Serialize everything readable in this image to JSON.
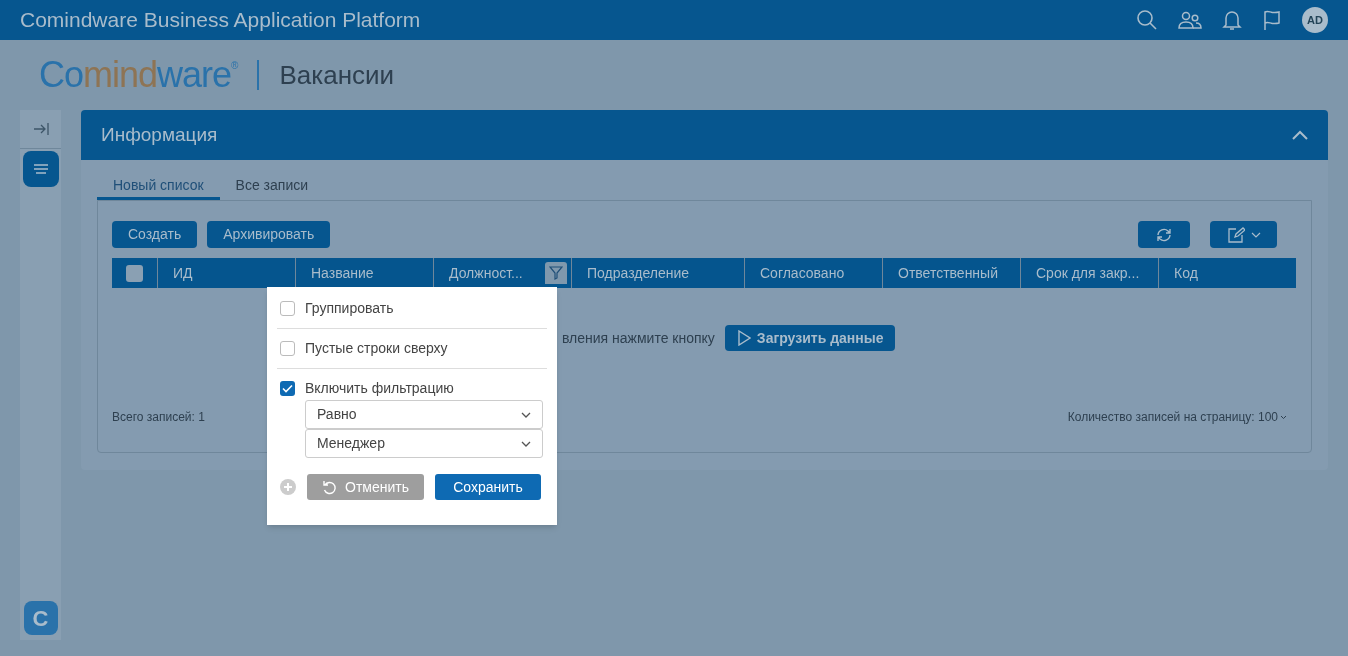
{
  "top_bar": {
    "title": "Comindware Business Application Platform",
    "avatar": "AD"
  },
  "logo": {
    "parts": [
      {
        "text": "Co",
        "color": "#2a72aa"
      },
      {
        "text": "mind",
        "color": "#8e7454"
      },
      {
        "text": "ware",
        "color": "#2a72aa"
      }
    ],
    "mark": "®"
  },
  "page_title": "Вакансии",
  "sidebar": {
    "app_badge": "C"
  },
  "card": {
    "title": "Информация",
    "expanded": true
  },
  "tabs": [
    {
      "label": "Новый список",
      "selected": true
    },
    {
      "label": "Все записи",
      "selected": false
    }
  ],
  "toolbar": {
    "buttons": [
      "Создать",
      "Архивировать"
    ]
  },
  "table": {
    "all_selected": false,
    "columns": [
      {
        "label": "ИД",
        "filtered": false
      },
      {
        "label": "Название",
        "filtered": false
      },
      {
        "label": "Должност...",
        "filtered": true
      },
      {
        "label": "Подразделение",
        "filtered": false
      },
      {
        "label": "Согласовано",
        "filtered": false
      },
      {
        "label": "Ответственный",
        "filtered": false
      },
      {
        "label": "Срок для закр...",
        "filtered": false
      },
      {
        "label": "Код",
        "filtered": false
      }
    ],
    "empty_message": "вления нажмите кнопку",
    "load_button": "Загрузить данные"
  },
  "footer": {
    "total": "Всего записей: 1",
    "page_size": "Количество записей на страницу: 100"
  },
  "popup": {
    "options": [
      {
        "label": "Группировать",
        "checked": false
      },
      {
        "label": "Пустые строки сверху",
        "checked": false
      },
      {
        "label": "Включить фильтрацию",
        "checked": true
      }
    ],
    "selects": [
      "Равно",
      "Менеджер"
    ],
    "cancel": "Отменить",
    "save": "Сохранить"
  }
}
